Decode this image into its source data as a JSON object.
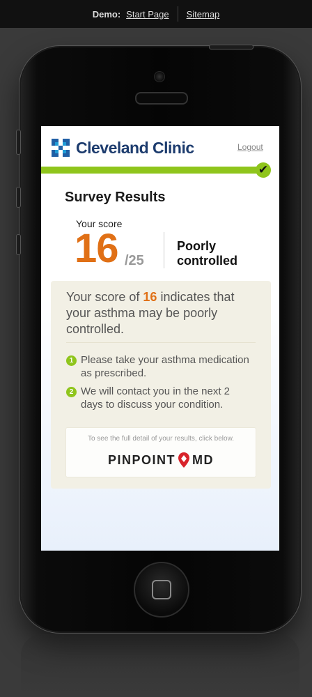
{
  "demo_bar": {
    "label": "Demo:",
    "start_page": "Start Page",
    "sitemap": "Sitemap"
  },
  "header": {
    "logo_text": "Cleveland Clinic",
    "logout": "Logout"
  },
  "survey": {
    "title": "Survey Results",
    "score_label": "Your score",
    "score": "16",
    "score_max": "/25",
    "status_line1": "Poorly",
    "status_line2": "controlled"
  },
  "summary": {
    "prefix": "Your score of ",
    "score": "16",
    "suffix": " indicates that your asthma may be poorly controlled."
  },
  "steps": [
    {
      "num": "1",
      "text": "Please take your asthma medication as prescribed."
    },
    {
      "num": "2",
      "text": "We will contact you in the next 2 days to discuss your condition."
    }
  ],
  "pinpoint": {
    "note": "To see the full detail of your results, click below.",
    "brand_left": "PINPOINT",
    "brand_right": "MD"
  },
  "colors": {
    "accent_orange": "#e07016",
    "accent_green": "#8fc51c",
    "brand_blue": "#1f5fa5"
  },
  "icons": {
    "progress_complete": "check-icon",
    "logo": "cleveland-cross-icon",
    "pinpoint": "map-pin-icon",
    "home": "home-button-icon"
  },
  "progress": 1.0
}
